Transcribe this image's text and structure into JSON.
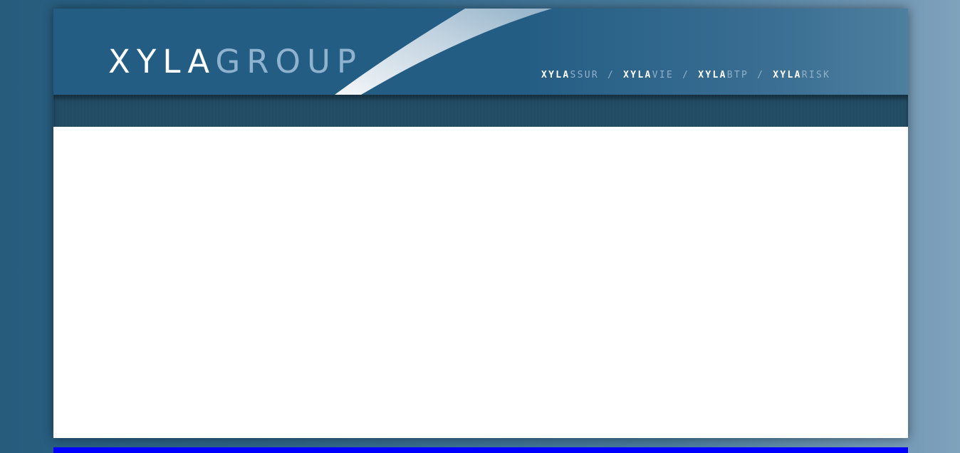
{
  "logo": {
    "part1": "XYLA",
    "part2": "GROUP"
  },
  "brands": [
    {
      "prefix": "XYLA",
      "suffix": "SSUR"
    },
    {
      "prefix": "XYLA",
      "suffix": "VIE"
    },
    {
      "prefix": "XYLA",
      "suffix": "BTP"
    },
    {
      "prefix": "XYLA",
      "suffix": "RISK"
    }
  ],
  "separator": "/",
  "colors": {
    "background": "#2f6589",
    "header": "#245d84",
    "nav_bar": "#1e4a63",
    "content": "#ffffff",
    "footer_bar": "#0000ff",
    "logo_accent": "#8fb3cf"
  }
}
